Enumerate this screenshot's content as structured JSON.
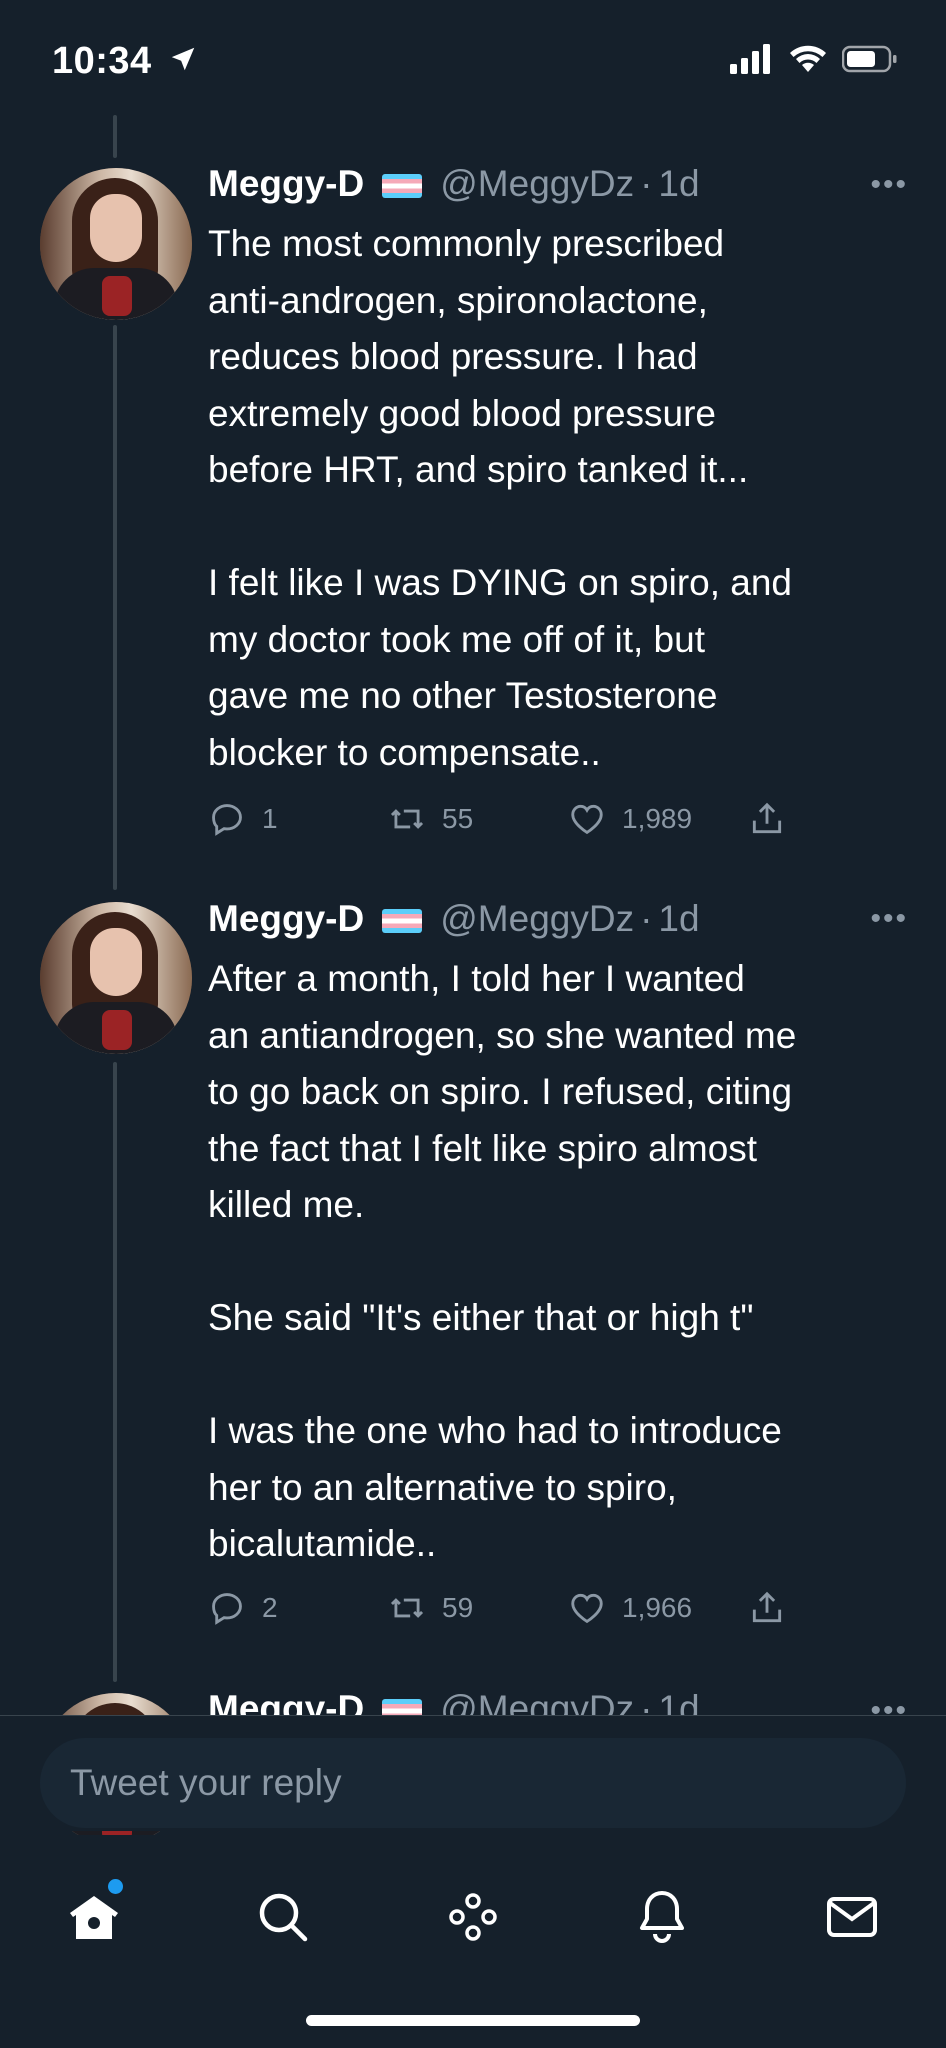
{
  "status_bar": {
    "time": "10:34"
  },
  "tweets": [
    {
      "name": "Meggy-D",
      "handle": "@MeggyDz",
      "separator": "·",
      "time": "1d",
      "text": "The most commonly prescribed\nanti-androgen, spironolactone,\nreduces blood pressure. I had\nextremely good blood pressure\nbefore HRT, and spiro tanked it...\n\nI felt like I was DYING on spiro, and\nmy doctor took me off of it, but\ngave me no other Testosterone\nblocker to compensate..",
      "replies": "1",
      "retweets": "55",
      "likes": "1,989"
    },
    {
      "name": "Meggy-D",
      "handle": "@MeggyDz",
      "separator": "·",
      "time": "1d",
      "text": "After a month, I told her I wanted\nan antiandrogen, so she wanted me\nto go back on spiro. I refused, citing\nthe fact that I felt like spiro almost\nkilled me.\n\nShe said \"It's either that or high t\"\n\nI was the one who had to introduce\nher to an alternative to spiro,\nbicalutamide..",
      "replies": "2",
      "retweets": "59",
      "likes": "1,966"
    },
    {
      "name": "Meggy-D",
      "handle": "@MeggyDz",
      "separator": "·",
      "time": "1d"
    }
  ],
  "reply_box": {
    "placeholder": "Tweet your reply"
  },
  "tab_bar": {
    "icons": [
      "home-icon",
      "search-icon",
      "spaces-icon",
      "notifications-icon",
      "messages-icon"
    ],
    "home_badge_color": "#1d9bf0"
  },
  "colors": {
    "background": "#15202b",
    "muted": "#8b98a5",
    "accent": "#1d9bf0"
  }
}
